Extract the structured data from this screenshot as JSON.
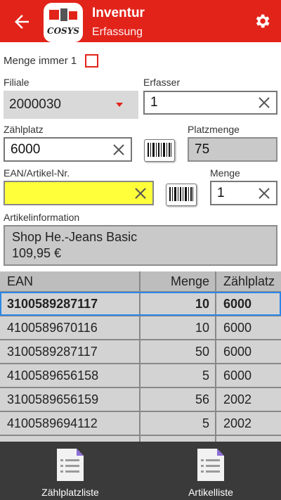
{
  "appbar": {
    "title": "Inventur",
    "subtitle": "Erfassung",
    "logo_text": "COSYS",
    "accent": "#e2231a",
    "icons": {
      "back": "arrow-left-icon",
      "settings": "gear-icon"
    }
  },
  "form": {
    "menge_immer_label": "Menge immer 1",
    "menge_immer_checked": false,
    "filiale_label": "Filiale",
    "filiale_value": "2000030",
    "erfasser_label": "Erfasser",
    "erfasser_value": "1",
    "zaehlplatz_label": "Zählplatz",
    "zaehlplatz_value": "6000",
    "platzmenge_label": "Platzmenge",
    "platzmenge_value": "75",
    "ean_label": "EAN/Artikel-Nr.",
    "ean_value": "",
    "menge_label": "Menge",
    "menge_value": "1",
    "artikelinfo_label": "Artikelinformation",
    "artikelinfo_line1": "Shop He.-Jeans Basic",
    "artikelinfo_line2": "109,95 €"
  },
  "table": {
    "headers": [
      "EAN",
      "Menge",
      "Zählplatz"
    ],
    "rows": [
      {
        "ean": "3100589287117",
        "menge": "10",
        "platz": "6000",
        "selected": true
      },
      {
        "ean": "4100589670116",
        "menge": "10",
        "platz": "6000"
      },
      {
        "ean": "3100589287117",
        "menge": "50",
        "platz": "6000"
      },
      {
        "ean": "4100589656158",
        "menge": "5",
        "platz": "6000"
      },
      {
        "ean": "3100589656159",
        "menge": "56",
        "platz": "2002"
      },
      {
        "ean": "4100589694112",
        "menge": "5",
        "platz": "2002"
      },
      {
        "ean": "",
        "menge": "",
        "platz": ""
      }
    ]
  },
  "bottom_nav": {
    "left_label": "Zählplatzliste",
    "right_label": "Artikelliste"
  }
}
